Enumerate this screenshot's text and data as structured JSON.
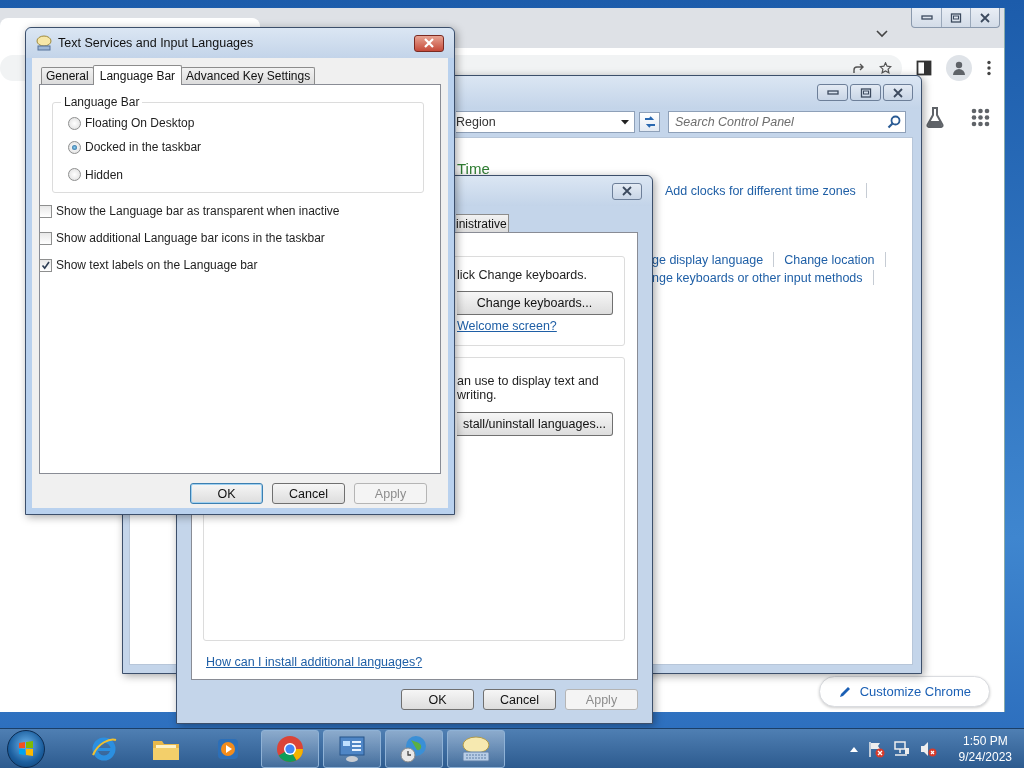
{
  "browser": {
    "customize_button": "Customize Chrome"
  },
  "control_panel": {
    "active": false,
    "address": "Region",
    "search": {
      "placeholder": "Search Control Panel"
    },
    "heading": "Time",
    "link_rows": [
      {
        "links": [
          "Add clocks for different time zones"
        ]
      },
      {
        "links": [
          "ge display language",
          "Change location"
        ]
      },
      {
        "links": [
          "nge keyboards or other input methods"
        ]
      }
    ]
  },
  "region_dialog": {
    "active": false,
    "tabs": [
      {
        "label": "inistrative",
        "selected": false
      }
    ],
    "keyboards_text": "lick Change keyboards.",
    "change_keyboards_button": "Change keyboards...",
    "welcome_link": "Welcome screen?",
    "display_text": [
      "an use to display text and",
      "writing."
    ],
    "install_button": "stall/uninstall languages...",
    "help_link": "How can I install additional languages?",
    "buttons": [
      {
        "label": "OK",
        "default": false,
        "disabled": false
      },
      {
        "label": "Cancel",
        "default": false,
        "disabled": false
      },
      {
        "label": "Apply",
        "default": false,
        "disabled": true
      }
    ]
  },
  "text_services": {
    "active": true,
    "title": "Text Services and Input Languages",
    "tabs": [
      {
        "label": "General",
        "selected": false
      },
      {
        "label": "Language Bar",
        "selected": true
      },
      {
        "label": "Advanced Key Settings",
        "selected": false
      }
    ],
    "group_label": "Language Bar",
    "radios": [
      {
        "label": "Floating On Desktop",
        "selected": false
      },
      {
        "label": "Docked in the taskbar",
        "selected": true
      },
      {
        "label": "Hidden",
        "selected": false
      }
    ],
    "checkboxes": [
      {
        "label": "Show the Language bar as transparent when inactive",
        "checked": false
      },
      {
        "label": "Show additional Language bar icons in the taskbar",
        "checked": false
      },
      {
        "label": "Show text labels on the Language bar",
        "checked": true
      }
    ],
    "buttons": [
      {
        "label": "OK",
        "default": true,
        "disabled": false
      },
      {
        "label": "Cancel",
        "default": false,
        "disabled": false
      },
      {
        "label": "Apply",
        "default": false,
        "disabled": true
      }
    ]
  },
  "taskbar": {
    "apps": [
      {
        "kind": "ie",
        "open": false
      },
      {
        "kind": "explorer",
        "open": false
      },
      {
        "kind": "media",
        "open": false
      },
      {
        "kind": "chrome",
        "open": true
      },
      {
        "kind": "control_panel",
        "open": true
      },
      {
        "kind": "region",
        "open": true
      },
      {
        "kind": "keyboard",
        "open": true
      }
    ],
    "clock": {
      "time": "1:50 PM",
      "date": "9/24/2023"
    }
  }
}
